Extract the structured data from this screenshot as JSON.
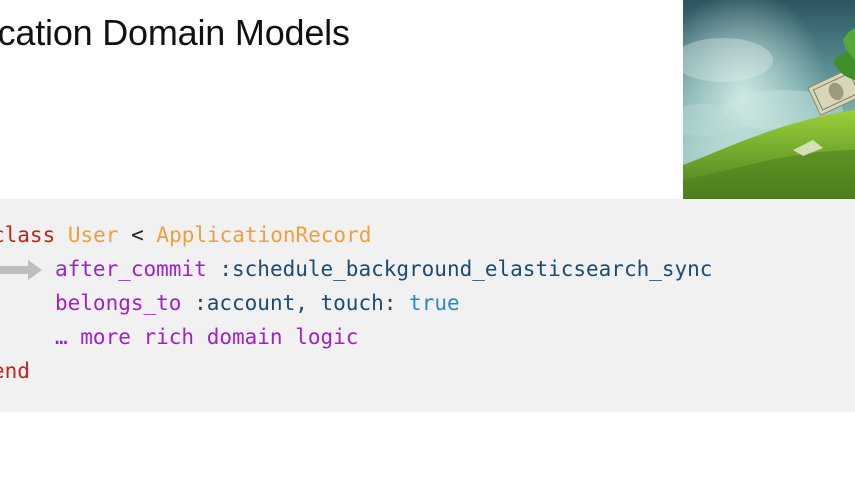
{
  "slide": {
    "title": "lication Domain Models"
  },
  "photo": {
    "icon": "money-plant-photo"
  },
  "code": {
    "line1": {
      "keyword": "class",
      "class_name": "User",
      "operator": "<",
      "parent": "ApplicationRecord"
    },
    "line2": {
      "method": "after_commit",
      "argument": ":schedule_background_elasticsearch_sync"
    },
    "line3": {
      "method": "belongs_to",
      "argument": ":account, touch:",
      "value": "true"
    },
    "line4": {
      "text": "… more rich domain logic"
    },
    "line5": {
      "keyword": "end"
    }
  },
  "colors": {
    "keyword": "#c0241b",
    "constant": "#f0a03a",
    "method": "#a21ecf",
    "symbol": "#1c4a73",
    "boolean": "#2f86c8",
    "code_background": "#f1f1f1",
    "arrow": "#bdbdbd"
  }
}
